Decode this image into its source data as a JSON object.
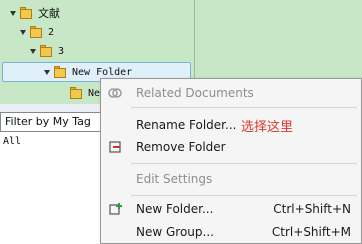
{
  "tree": {
    "items": [
      {
        "label": "文献"
      },
      {
        "label": "2"
      },
      {
        "label": "3"
      },
      {
        "label": "New Folder"
      },
      {
        "label": "Ne"
      }
    ]
  },
  "filter": {
    "dropdown_label": "Filter by My Tag",
    "items": [
      {
        "label": "All"
      }
    ]
  },
  "context_menu": {
    "items": [
      {
        "label": "Related Documents",
        "icon": "related-documents-icon",
        "enabled": false
      },
      {
        "label": "Rename Folder...",
        "enabled": true
      },
      {
        "label": "Remove Folder",
        "icon": "remove-folder-icon",
        "enabled": true
      },
      {
        "label": "Edit Settings",
        "enabled": false
      },
      {
        "label": "New Folder...",
        "shortcut": "Ctrl+Shift+N",
        "icon": "new-folder-icon",
        "enabled": true
      },
      {
        "label": "New Group...",
        "shortcut": "Ctrl+Shift+M",
        "enabled": true
      }
    ]
  },
  "annotation": {
    "text": "选择这里",
    "color": "#e0362f"
  }
}
